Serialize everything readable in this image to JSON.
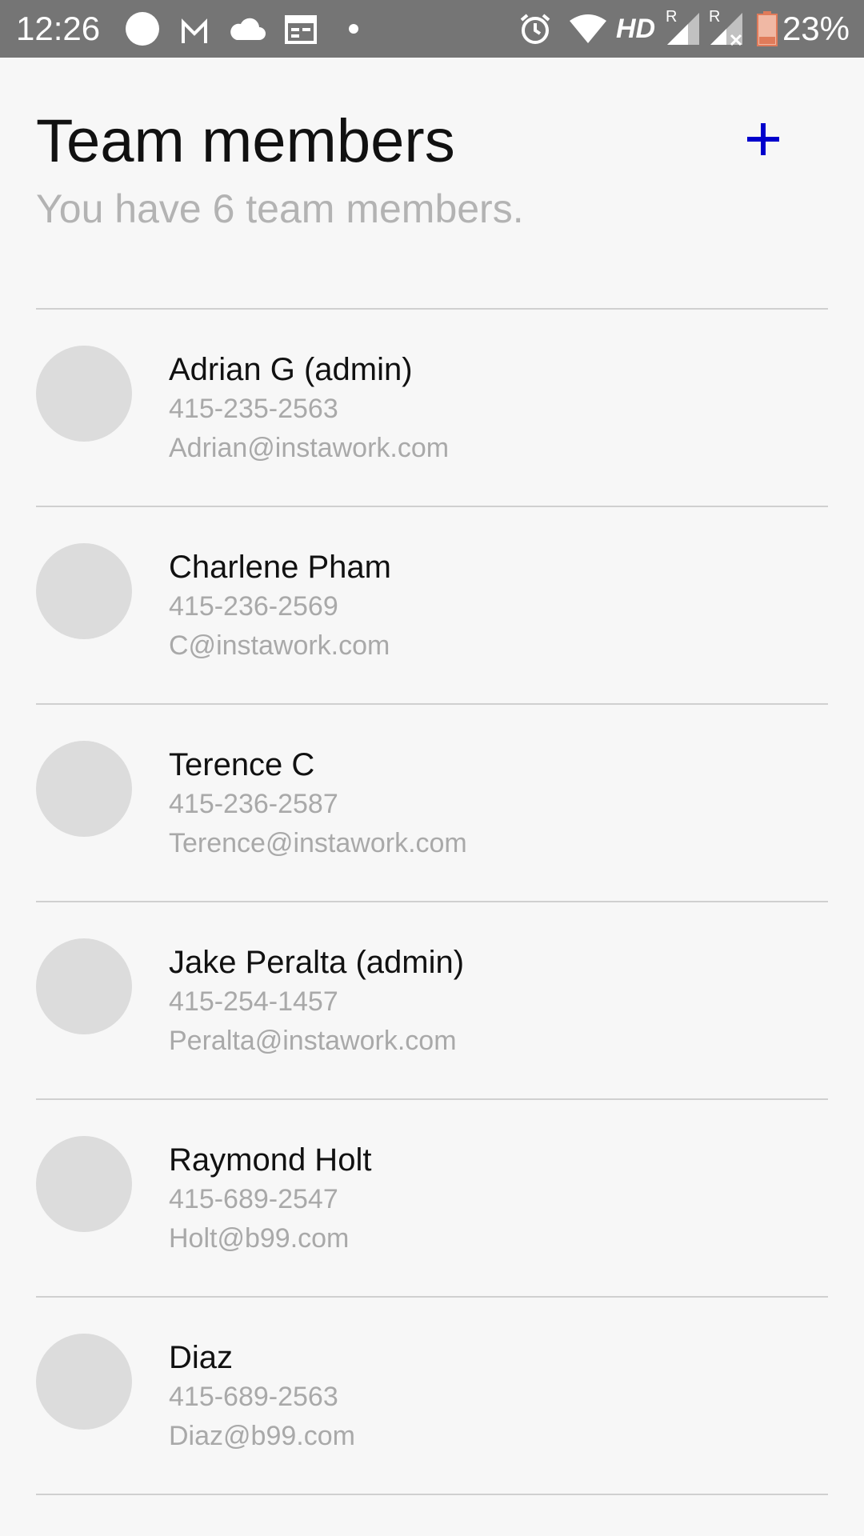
{
  "status_bar": {
    "time": "12:26",
    "network": "HD",
    "battery_percent": "23%",
    "icons": [
      "circle-notification-icon",
      "gmail-icon",
      "cloud-icon",
      "calendar-icon",
      "dot-icon",
      "alarm-icon",
      "wifi-icon",
      "signal-icon",
      "signal-no-service-icon",
      "battery-icon"
    ],
    "roaming_marker": "R"
  },
  "header": {
    "title": "Team members",
    "subtitle": "You have 6 team members.",
    "add_icon": "plus-icon",
    "accent_color": "#0000cc"
  },
  "members": [
    {
      "name": "Adrian G (admin)",
      "phone": "415-235-2563",
      "email": "Adrian@instawork.com"
    },
    {
      "name": "Charlene Pham",
      "phone": "415-236-2569",
      "email": "C@instawork.com"
    },
    {
      "name": "Terence C",
      "phone": "415-236-2587",
      "email": "Terence@instawork.com"
    },
    {
      "name": "Jake Peralta (admin)",
      "phone": "415-254-1457",
      "email": "Peralta@instawork.com"
    },
    {
      "name": "Raymond Holt",
      "phone": "415-689-2547",
      "email": "Holt@b99.com"
    },
    {
      "name": "Diaz",
      "phone": "415-689-2563",
      "email": "Diaz@b99.com"
    }
  ]
}
